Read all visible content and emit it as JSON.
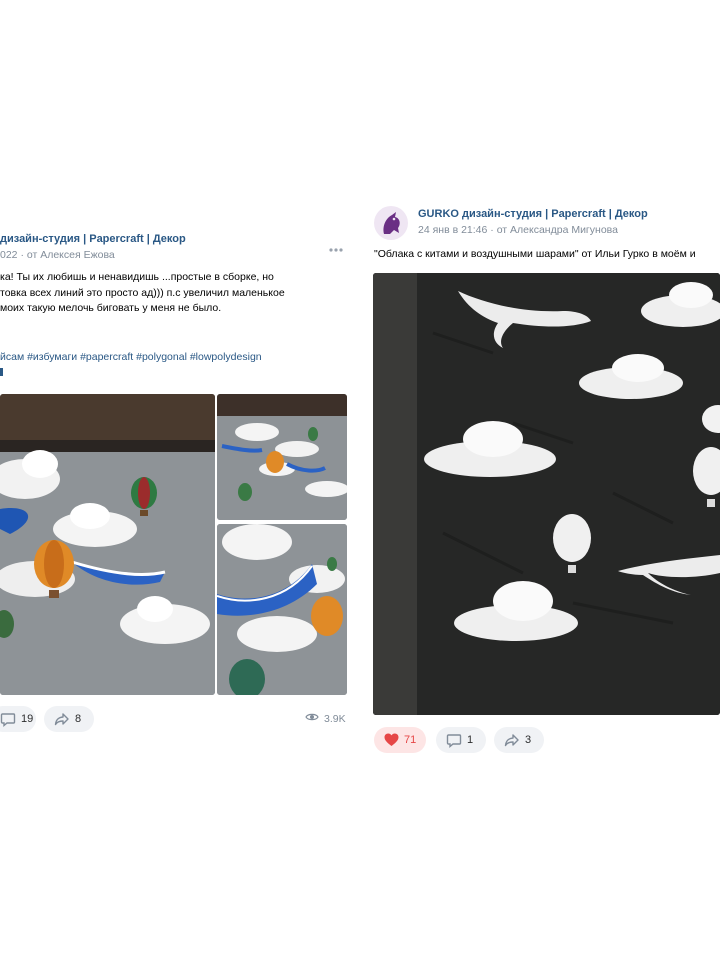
{
  "post_left": {
    "group_name": "дизайн-студия | Papercraft | Декор",
    "date": "022",
    "author": "· от Алексея Ежова",
    "text_lines": [
      "ка! Ты их любишь и ненавидишь ...простые в сборке, но",
      "товка всех линий это просто ад))) п.с увеличил маленькое",
      "моих такую мелочь биговать у меня не было."
    ],
    "hashtags": "йсам #избумаги #papercraft #polygonal #lowpolydesign",
    "comments": "19",
    "shares": "8",
    "views": "3.9K"
  },
  "post_right": {
    "group_name": "GURKO дизайн-студия | Papercraft | Декор",
    "date": "24 янв в 21:46",
    "author": "· от Александра Мигунова",
    "text": "\"Облака с китами и воздушными шарами\" от Ильи Гурко в моём и",
    "likes": "71",
    "comments": "1",
    "shares": "3"
  },
  "icons": {
    "more": "more-dots-icon",
    "comment": "comment-icon",
    "share": "share-icon",
    "like": "heart-icon",
    "views": "eye-icon"
  },
  "colors": {
    "link": "#2a5885",
    "meta": "#818c99",
    "like": "#e64646",
    "pill_bg": "#f0f2f5"
  }
}
